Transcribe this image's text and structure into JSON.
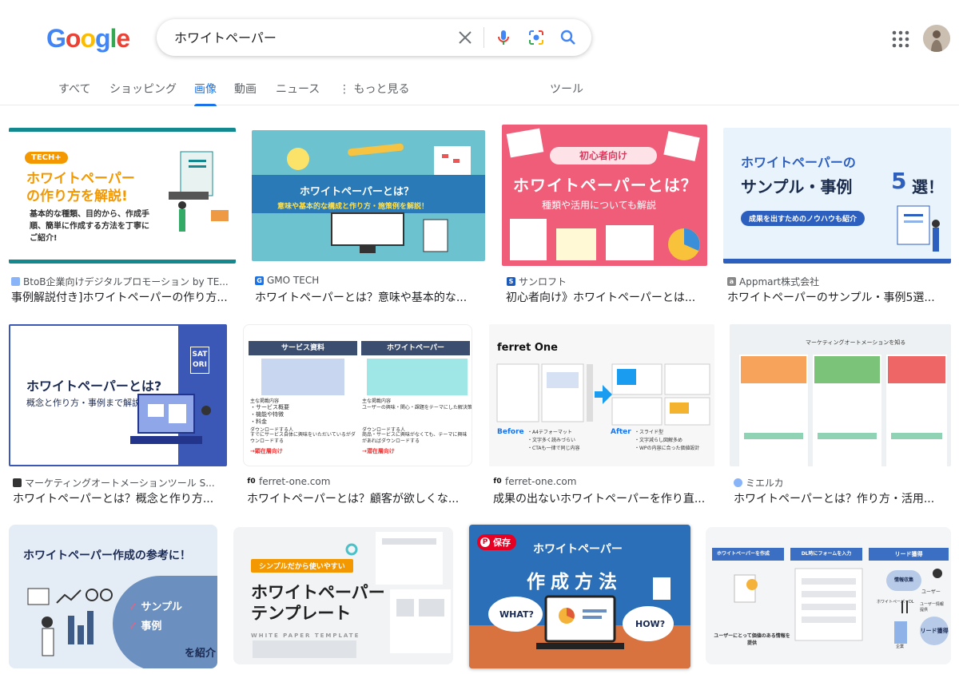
{
  "brand": {
    "logo_letters": [
      "G",
      "o",
      "o",
      "g",
      "l",
      "e"
    ],
    "colors": [
      "#4285f4",
      "#ea4335",
      "#fbbc05",
      "#4285f4",
      "#34a853",
      "#ea4335"
    ]
  },
  "search": {
    "query": "ホワイトペーパー"
  },
  "tabs": [
    "すべて",
    "ショッピング",
    "画像",
    "動画",
    "ニュース",
    "もっと見る",
    "ツール"
  ],
  "active_tab": "画像",
  "results": [
    {
      "source": "BtoB企業向けデジタルプロモーション by TE...",
      "title": "事例解説付き]ホワイトペーパーの作り方...",
      "fav_icon": "globe-icon",
      "badge": "TECH+",
      "head1": "ホワイトペーパー",
      "head2": "の作り方を解説!",
      "body1": "基本的な種類、目的から、作成手",
      "body2": "順、簡単に作成する方法を丁寧に",
      "body3": "ご紹介!"
    },
    {
      "source": "GMO TECH",
      "title": "ホワイトペーパーとは？意味や基本的な...",
      "fav_icon": "gmo-icon",
      "head1": "ホワイトペーパーとは？",
      "sub1": "意味や基本的な構成と作り方・施策例を解説！"
    },
    {
      "source": "サンロフト",
      "title": "初心者向け》ホワイトペーパーとは...",
      "fav_icon": "s-icon",
      "badge": "初心者向け",
      "head1": "ホワイトペーパーとは？",
      "sub1": "種類や活用についても解説"
    },
    {
      "source": "Appmart株式会社",
      "title": "ホワイトペーパーのサンプル・事例5選...",
      "fav_icon": "appmart-icon",
      "head1": "ホワイトペーパーの",
      "head2": "サンプル・事例",
      "num": "5",
      "head3": "選！",
      "sub1": "成果を出すためのノウハウも紹介"
    },
    {
      "source": "マーケティングオートメーションツール S...",
      "title": "ホワイトペーパーとは？概念と作り方...",
      "fav_icon": "satori-icon",
      "brand": "SATORI",
      "head1": "ホワイトペーパーとは?",
      "sub1": "概念と作り方・事例まで解説"
    },
    {
      "source": "ferret-one.com",
      "title": "ホワイトペーパーとは？顧客が欲しくな...",
      "fav_icon": "f0-icon",
      "fav_text": "f0",
      "col1": "サービス資料",
      "col2": "ホワイトペーパー",
      "l1": "主な掲載内容",
      "l2": "・サービス概要",
      "l3": "・機能や特徴",
      "l4": "・料金",
      "l5": "ダウンロードする人",
      "l6": "すでにサービス自体に興味をいただいているがダウンロードする",
      "l7": "→顕在層向け",
      "r1": "主な掲載内容",
      "r2": "ユーザーの興味・関心・課題をテーマにした解決策",
      "r3": "ダウンロードする人",
      "r4": "商品・サービスに興味がなくても、テーマに興味があればダウンロードする",
      "r5": "→潜在層向け"
    },
    {
      "source": "ferret-one.com",
      "title": "成果の出ないホワイトペーパーを作り直...",
      "fav_icon": "f0-icon",
      "fav_text": "f0",
      "brand": "ferret One",
      "before": "Before",
      "after": "After",
      "b1": "・A4テフォーマット",
      "b2": "・文字多く読みづらい",
      "b3": "・CTAも一律で同じ内容",
      "a1": "・スライド型",
      "a2": "・文字減らし図解多め",
      "a3": "・WPの内容に合った価値設計"
    },
    {
      "source": "ミエルカ",
      "title": "ホワイトペーパーとは？作り方・活用...",
      "fav_icon": "mieruka-icon",
      "head1": "マーケティングオートメーションを知る"
    },
    {
      "head1": "ホワイトペーパー作成の参考に！",
      "item1": "サンプル",
      "item2": "事例",
      "tail": "を紹介"
    },
    {
      "badge": "シンプルだから使いやすい",
      "head1": "ホワイトペーパー",
      "head2": "テンプレート",
      "sub1": "WHITE PAPER TEMPLATE"
    },
    {
      "save": "保存",
      "head1": "ホワイトペーパー",
      "head2": "作成方法",
      "q1": "WHAT?",
      "q2": "HOW?"
    },
    {
      "c1": "ホワイトペーパーを作成",
      "c2": "DL時にフォームを入力",
      "c3": "リード獲得",
      "n1": "情報収集",
      "n2": "ユーザー",
      "n3": "ホワイトペーパーDL",
      "n4": "ユーザー情報提供",
      "n5": "企業",
      "n6": "リード獲得",
      "f1": "ユーザーにとって価値のある情報を提供"
    }
  ]
}
